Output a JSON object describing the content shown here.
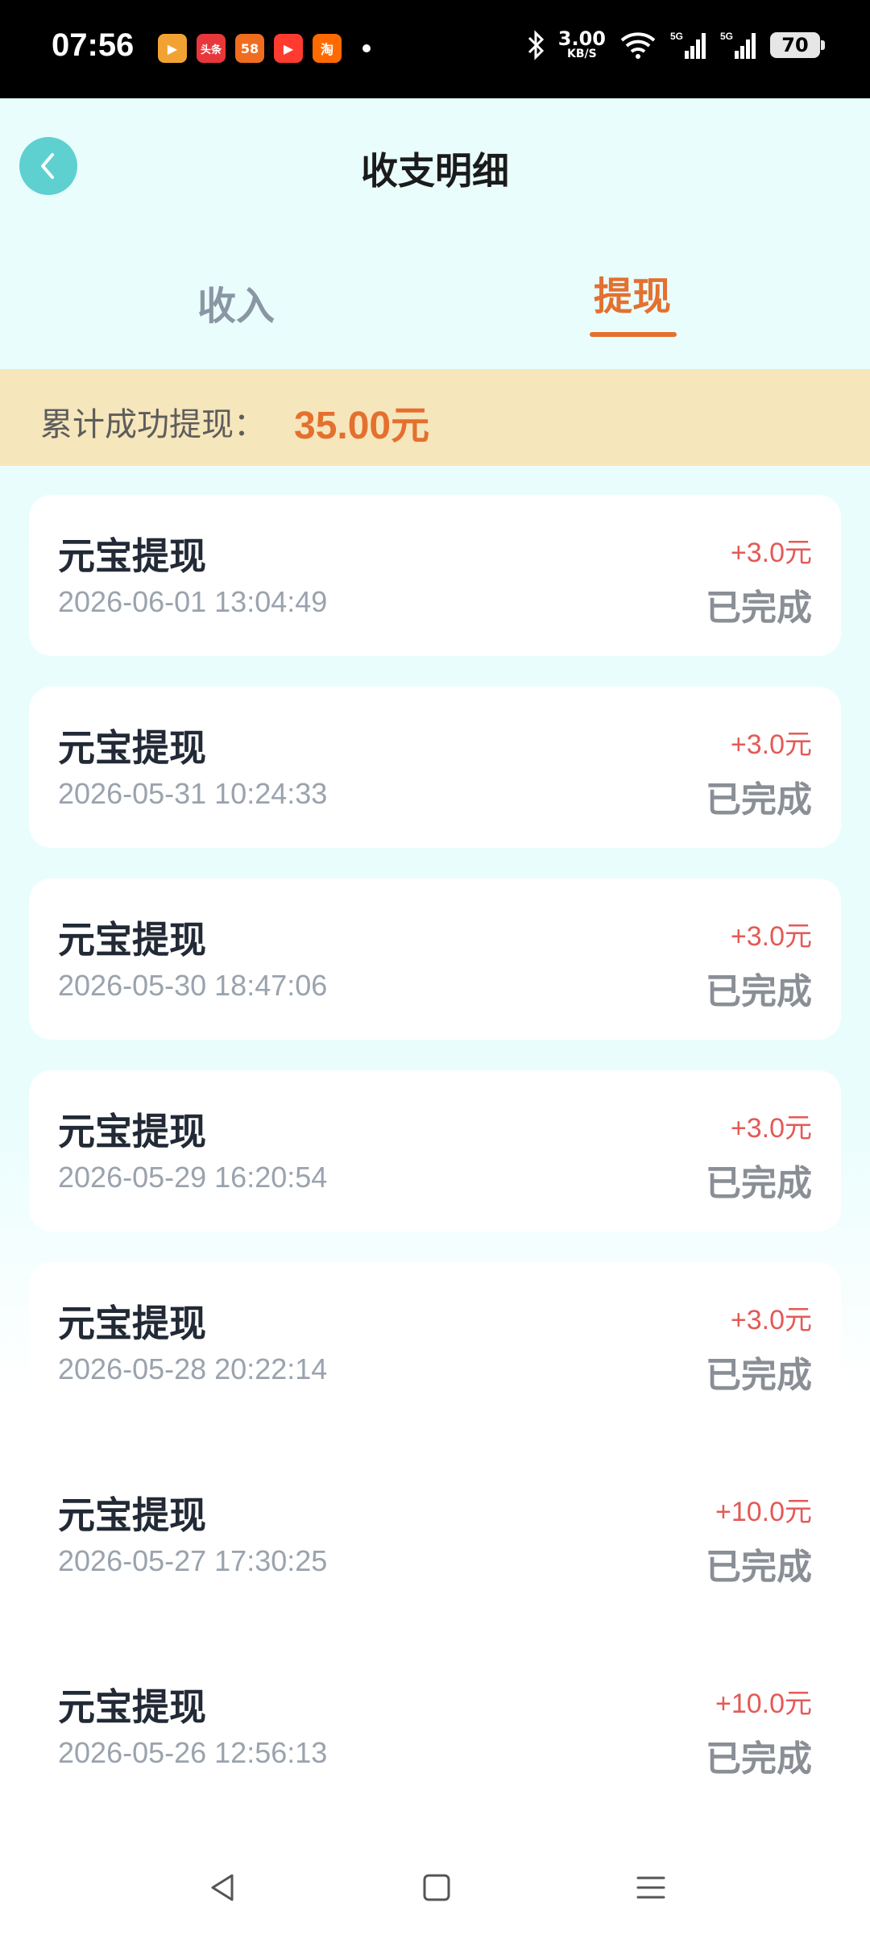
{
  "status_bar": {
    "time": "07:56",
    "app_icons": [
      {
        "name": "video-app-icon",
        "glyph": "▶",
        "color": "#f2a233"
      },
      {
        "name": "toutiao-app-icon",
        "glyph": "头条",
        "color": "#e8373b"
      },
      {
        "name": "58-app-icon",
        "glyph": "58",
        "color": "#f06d20"
      },
      {
        "name": "kuaishou-app-icon",
        "glyph": "▶",
        "color": "#ff3b30"
      },
      {
        "name": "taobao-app-icon",
        "glyph": "淘",
        "color": "#ff6a00"
      }
    ],
    "net_speed_value": "3.00",
    "net_speed_unit": "KB/S",
    "battery": "70"
  },
  "header": {
    "title": "收支明细"
  },
  "tabs": [
    {
      "label": "收入",
      "active": false
    },
    {
      "label": "提现",
      "active": true
    }
  ],
  "summary": {
    "label": "累计成功提现：",
    "value": "35.00元"
  },
  "records": [
    {
      "title": "元宝提现",
      "time": "2026-06-01 13:04:49",
      "amount": "+3.0元",
      "status": "已完成"
    },
    {
      "title": "元宝提现",
      "time": "2026-05-31 10:24:33",
      "amount": "+3.0元",
      "status": "已完成"
    },
    {
      "title": "元宝提现",
      "time": "2026-05-30 18:47:06",
      "amount": "+3.0元",
      "status": "已完成"
    },
    {
      "title": "元宝提现",
      "time": "2026-05-29 16:20:54",
      "amount": "+3.0元",
      "status": "已完成"
    },
    {
      "title": "元宝提现",
      "time": "2026-05-28 20:22:14",
      "amount": "+3.0元",
      "status": "已完成"
    },
    {
      "title": "元宝提现",
      "time": "2026-05-27 17:30:25",
      "amount": "+10.0元",
      "status": "已完成"
    },
    {
      "title": "元宝提现",
      "time": "2026-05-26 12:56:13",
      "amount": "+10.0元",
      "status": "已完成"
    }
  ],
  "colors": {
    "accent": "#e4702f",
    "amount": "#e35a56",
    "back_button": "#5fd0d0",
    "summary_bg": "#f6e6bb"
  }
}
